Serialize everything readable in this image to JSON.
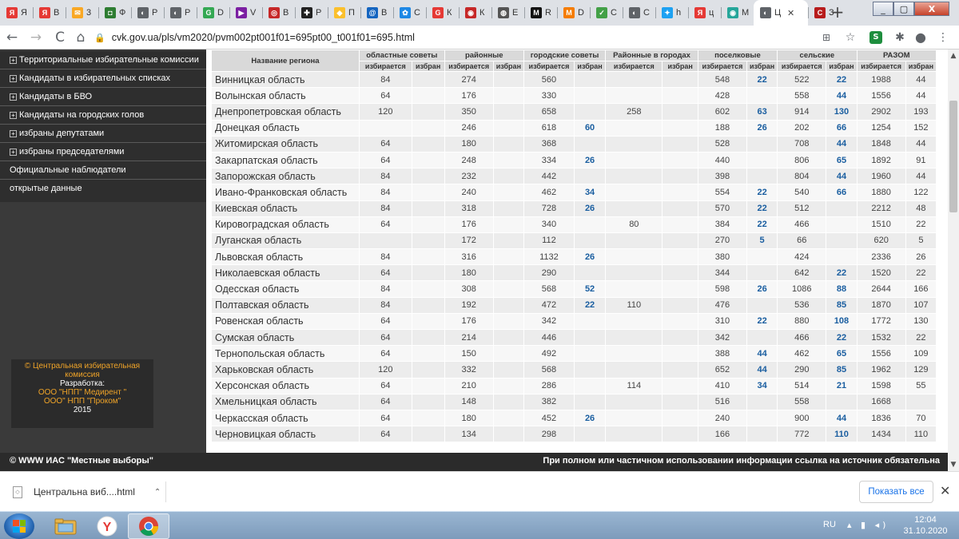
{
  "browser": {
    "tabs": [
      {
        "fav": "Я",
        "color": "#e53935",
        "title": "Я"
      },
      {
        "fav": "Я",
        "color": "#e53935",
        "title": "В"
      },
      {
        "fav": "✉",
        "color": "#f9a825",
        "title": "3"
      },
      {
        "fav": "◘",
        "color": "#2e7d32",
        "title": "Ф"
      },
      {
        "fav": "◐",
        "color": "#5f6368",
        "title": "Р"
      },
      {
        "fav": "◐",
        "color": "#5f6368",
        "title": "Р"
      },
      {
        "fav": "G",
        "color": "#34a853",
        "title": "D"
      },
      {
        "fav": "▶",
        "color": "#7b1fa2",
        "title": "V"
      },
      {
        "fav": "◎",
        "color": "#c62828",
        "title": "В"
      },
      {
        "fav": "✚",
        "color": "#212121",
        "title": "Р"
      },
      {
        "fav": "◆",
        "color": "#fbc02d",
        "title": "П"
      },
      {
        "fav": "@",
        "color": "#1565c0",
        "title": "В"
      },
      {
        "fav": "✿",
        "color": "#1e88e5",
        "title": "С"
      },
      {
        "fav": "G",
        "color": "#e53935",
        "title": "К"
      },
      {
        "fav": "◉",
        "color": "#c62828",
        "title": "К"
      },
      {
        "fav": "◍",
        "color": "#555555",
        "title": "Е"
      },
      {
        "fav": "M",
        "color": "#111111",
        "title": "R"
      },
      {
        "fav": "M",
        "color": "#f57c00",
        "title": "D"
      },
      {
        "fav": "✓",
        "color": "#43a047",
        "title": "С"
      },
      {
        "fav": "◐",
        "color": "#5f6368",
        "title": "С"
      },
      {
        "fav": "✦",
        "color": "#1da1f2",
        "title": "h"
      },
      {
        "fav": "Я",
        "color": "#e53935",
        "title": "ц"
      },
      {
        "fav": "◉",
        "color": "#26a69a",
        "title": "М"
      },
      {
        "fav": "◐",
        "color": "#5f6368",
        "title": "Ц",
        "active": true
      },
      {
        "fav": "C",
        "color": "#b71c1c",
        "title": "З"
      }
    ],
    "new_tab": "+",
    "window_controls": {
      "minimize": "_",
      "restore": "▢",
      "close": "X"
    },
    "nav": {
      "back": "←",
      "forward": "→",
      "reload": "C",
      "home": "⌂"
    },
    "url": "cvk.gov.ua/pls/vm2020/pvm002pt001f01=695pt00_t001f01=695.html"
  },
  "sidebar": {
    "menu": [
      {
        "label": "Территориальные избирательные комиссии",
        "expandable": true
      },
      {
        "label": "Кандидаты в избирательных списках",
        "expandable": true
      },
      {
        "label": "Кандидаты в БВО",
        "expandable": true
      },
      {
        "label": "Кандидаты на городских голов",
        "expandable": true
      },
      {
        "label": "избраны депутатами",
        "expandable": true
      },
      {
        "label": "избраны председателями",
        "expandable": true
      },
      {
        "label": "Официальные наблюдатели",
        "expandable": false
      },
      {
        "label": "открытые данные",
        "expandable": false
      }
    ],
    "credits": {
      "org_line1": "©  Центральная избирательная",
      "org_line2": "комиссия",
      "dev_label": "Разработка:",
      "dev1": "ООО \"НПП\" Медирент \"",
      "dev2": "ООО\" НПП \"Проком\"",
      "year": "2015"
    }
  },
  "table": {
    "region_header": "Название региона",
    "groups": [
      "областные советы",
      "районные",
      "городские советы",
      "Районные в городах",
      "поселковые",
      "сельские",
      "РАЗОМ"
    ],
    "subheaders": [
      "избирается",
      "избран"
    ],
    "rows": [
      {
        "region": "Винницкая область",
        "v": [
          "84",
          "",
          "274",
          "",
          "560",
          "",
          "",
          "",
          "548",
          "22",
          "522",
          "22",
          "1988",
          "44"
        ]
      },
      {
        "region": "Волынская область",
        "v": [
          "64",
          "",
          "176",
          "",
          "330",
          "",
          "",
          "",
          "428",
          "",
          "558",
          "44",
          "1556",
          "44"
        ]
      },
      {
        "region": "Днепропетровская область",
        "v": [
          "120",
          "",
          "350",
          "",
          "658",
          "",
          "258",
          "",
          "602",
          "63",
          "914",
          "130",
          "2902",
          "193"
        ]
      },
      {
        "region": "Донецкая область",
        "v": [
          "",
          "",
          "246",
          "",
          "618",
          "60",
          "",
          "",
          "188",
          "26",
          "202",
          "66",
          "1254",
          "152"
        ]
      },
      {
        "region": "Житомирская область",
        "v": [
          "64",
          "",
          "180",
          "",
          "368",
          "",
          "",
          "",
          "528",
          "",
          "708",
          "44",
          "1848",
          "44"
        ]
      },
      {
        "region": "Закарпатская область",
        "v": [
          "64",
          "",
          "248",
          "",
          "334",
          "26",
          "",
          "",
          "440",
          "",
          "806",
          "65",
          "1892",
          "91"
        ]
      },
      {
        "region": "Запорожская область",
        "v": [
          "84",
          "",
          "232",
          "",
          "442",
          "",
          "",
          "",
          "398",
          "",
          "804",
          "44",
          "1960",
          "44"
        ]
      },
      {
        "region": "Ивано-Франковская область",
        "v": [
          "84",
          "",
          "240",
          "",
          "462",
          "34",
          "",
          "",
          "554",
          "22",
          "540",
          "66",
          "1880",
          "122"
        ]
      },
      {
        "region": "Киевская область",
        "v": [
          "84",
          "",
          "318",
          "",
          "728",
          "26",
          "",
          "",
          "570",
          "22",
          "512",
          "",
          "2212",
          "48"
        ]
      },
      {
        "region": "Кировоградская область",
        "v": [
          "64",
          "",
          "176",
          "",
          "340",
          "",
          "80",
          "",
          "384",
          "22",
          "466",
          "",
          "1510",
          "22"
        ]
      },
      {
        "region": "Луганская область",
        "v": [
          "",
          "",
          "172",
          "",
          "112",
          "",
          "",
          "",
          "270",
          "5",
          "66",
          "",
          "620",
          "5"
        ]
      },
      {
        "region": "Львовская область",
        "v": [
          "84",
          "",
          "316",
          "",
          "1132",
          "26",
          "",
          "",
          "380",
          "",
          "424",
          "",
          "2336",
          "26"
        ]
      },
      {
        "region": "Николаевская область",
        "v": [
          "64",
          "",
          "180",
          "",
          "290",
          "",
          "",
          "",
          "344",
          "",
          "642",
          "22",
          "1520",
          "22"
        ]
      },
      {
        "region": "Одесская область",
        "v": [
          "84",
          "",
          "308",
          "",
          "568",
          "52",
          "",
          "",
          "598",
          "26",
          "1086",
          "88",
          "2644",
          "166"
        ]
      },
      {
        "region": "Полтавская область",
        "v": [
          "84",
          "",
          "192",
          "",
          "472",
          "22",
          "110",
          "",
          "476",
          "",
          "536",
          "85",
          "1870",
          "107"
        ]
      },
      {
        "region": "Ровенская область",
        "v": [
          "64",
          "",
          "176",
          "",
          "342",
          "",
          "",
          "",
          "310",
          "22",
          "880",
          "108",
          "1772",
          "130"
        ]
      },
      {
        "region": "Сумская область",
        "v": [
          "64",
          "",
          "214",
          "",
          "446",
          "",
          "",
          "",
          "342",
          "",
          "466",
          "22",
          "1532",
          "22"
        ]
      },
      {
        "region": "Тернопольская область",
        "v": [
          "64",
          "",
          "150",
          "",
          "492",
          "",
          "",
          "",
          "388",
          "44",
          "462",
          "65",
          "1556",
          "109"
        ]
      },
      {
        "region": "Харьковская область",
        "v": [
          "120",
          "",
          "332",
          "",
          "568",
          "",
          "",
          "",
          "652",
          "44",
          "290",
          "85",
          "1962",
          "129"
        ]
      },
      {
        "region": "Херсонская область",
        "v": [
          "64",
          "",
          "210",
          "",
          "286",
          "",
          "114",
          "",
          "410",
          "34",
          "514",
          "21",
          "1598",
          "55"
        ]
      },
      {
        "region": "Хмельницкая область",
        "v": [
          "64",
          "",
          "148",
          "",
          "382",
          "",
          "",
          "",
          "516",
          "",
          "558",
          "",
          "1668",
          ""
        ]
      },
      {
        "region": "Черкасская область",
        "v": [
          "64",
          "",
          "180",
          "",
          "452",
          "26",
          "",
          "",
          "240",
          "",
          "900",
          "44",
          "1836",
          "70"
        ]
      },
      {
        "region": "Черновицкая область",
        "v": [
          "64",
          "",
          "134",
          "",
          "298",
          "",
          "",
          "",
          "166",
          "",
          "772",
          "110",
          "1434",
          "110"
        ]
      }
    ]
  },
  "footer": {
    "left": "© WWW ИАС \"Местные выборы\"",
    "right": "При полном или частичном использовании информации ссылка на источник обязательна"
  },
  "downloads": {
    "file": "Центральна виб....html",
    "show_all": "Показать все",
    "close": "✕"
  },
  "taskbar": {
    "lang": "RU",
    "time": "12:04",
    "date": "31.10.2020"
  }
}
